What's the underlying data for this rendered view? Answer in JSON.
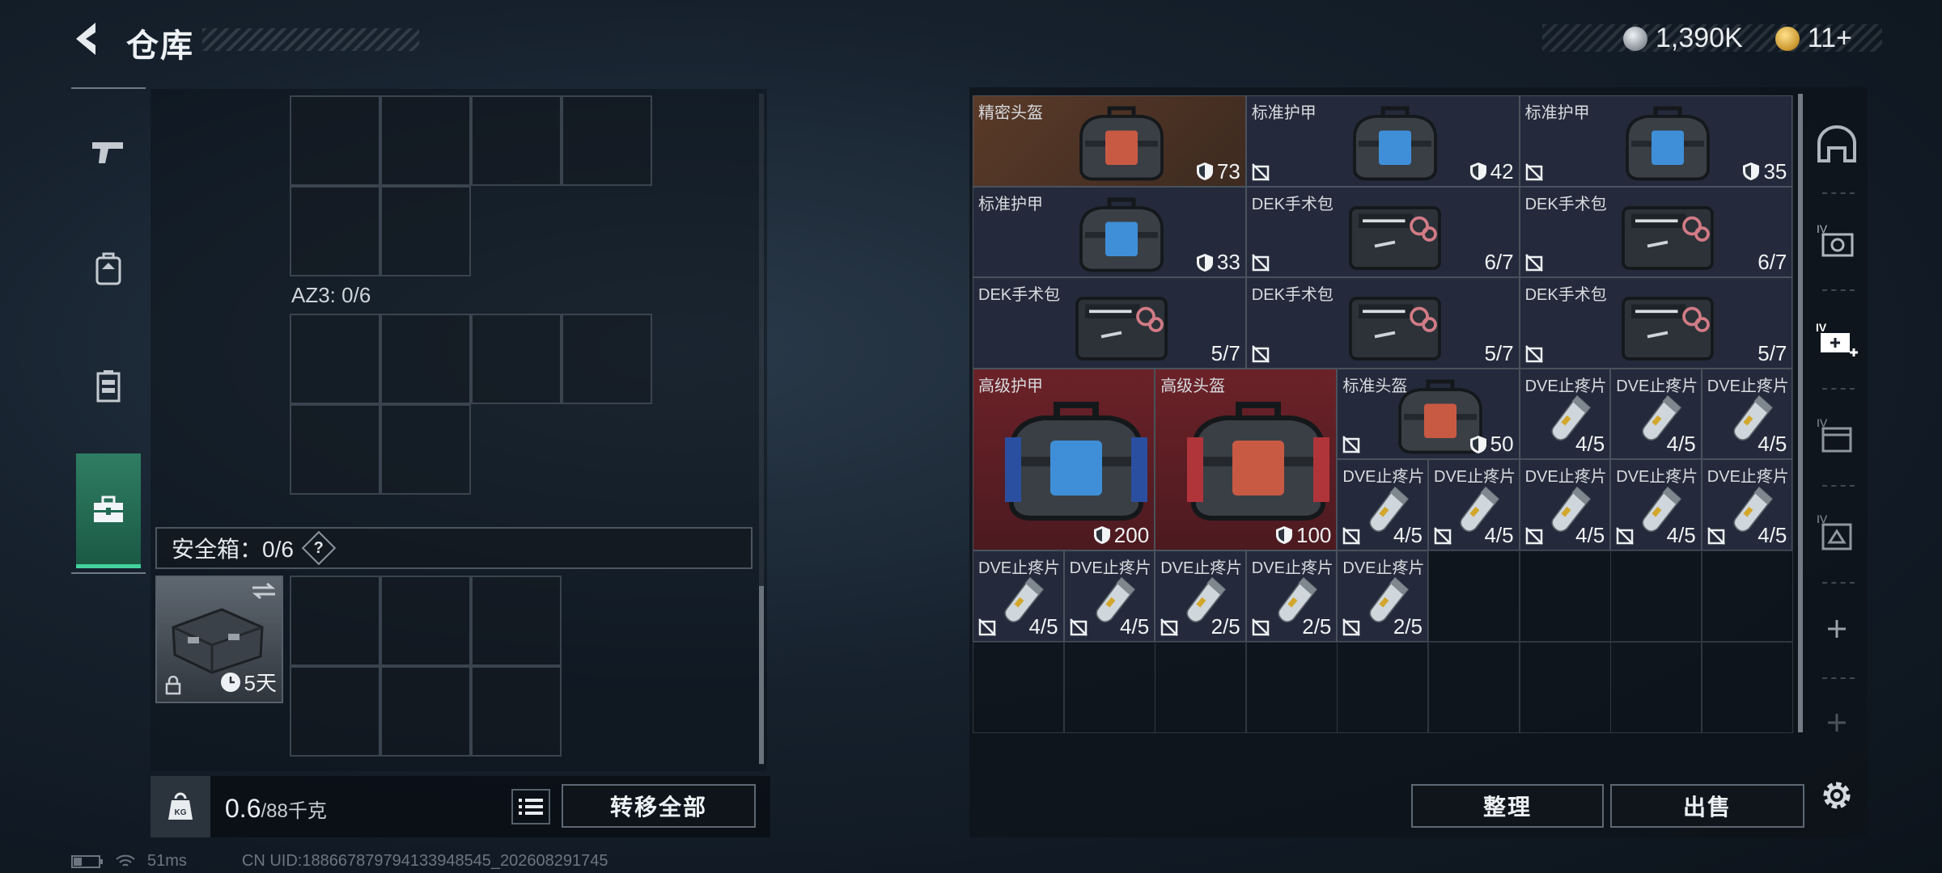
{
  "header": {
    "title": "仓库",
    "currency_1": "1,390K",
    "currency_2": "11+"
  },
  "left_panel": {
    "az3_label": "AZ3: 0/6",
    "safe_box_label": "安全箱：0/6",
    "safe_help": "?",
    "safe_item_duration": "5天",
    "weight_value": "0.6",
    "weight_max": "/88千克",
    "weight_icon_label": "KG",
    "transfer_all": "转移全部"
  },
  "right_panel": {
    "sort_label": "整理",
    "sell_label": "出售",
    "items": [
      {
        "name": "精密头盔",
        "value": "73",
        "bg": "brown",
        "shield": true,
        "noinsure": false,
        "pic": "helmet-case-red"
      },
      {
        "name": "标准护甲",
        "value": "42",
        "bg": "navy",
        "shield": true,
        "noinsure": true,
        "pic": "armor-case-blue"
      },
      {
        "name": "标准护甲",
        "value": "35",
        "bg": "navy",
        "shield": true,
        "noinsure": true,
        "pic": "armor-case-blue"
      },
      {
        "name": "标准护甲",
        "value": "33",
        "bg": "navy",
        "shield": true,
        "noinsure": false,
        "pic": "armor-case-blue"
      },
      {
        "name": "DEK手术包",
        "value": "6/7",
        "bg": "navy",
        "shield": false,
        "noinsure": true,
        "pic": "first-aid-kit"
      },
      {
        "name": "DEK手术包",
        "value": "6/7",
        "bg": "navy",
        "shield": false,
        "noinsure": true,
        "pic": "first-aid-kit"
      },
      {
        "name": "DEK手术包",
        "value": "5/7",
        "bg": "navy",
        "shield": false,
        "noinsure": false,
        "pic": "first-aid-kit"
      },
      {
        "name": "DEK手术包",
        "value": "5/7",
        "bg": "navy",
        "shield": false,
        "noinsure": true,
        "pic": "first-aid-kit"
      },
      {
        "name": "DEK手术包",
        "value": "5/7",
        "bg": "navy",
        "shield": false,
        "noinsure": true,
        "pic": "first-aid-kit"
      },
      {
        "name": "高级护甲",
        "value": "200",
        "bg": "red",
        "shield": true,
        "noinsure": false,
        "pic": "armor-case-large"
      },
      {
        "name": "高级头盔",
        "value": "100",
        "bg": "red",
        "shield": true,
        "noinsure": false,
        "pic": "helmet-case-large"
      },
      {
        "name": "标准头盔",
        "value": "50",
        "bg": "navy",
        "shield": true,
        "noinsure": true,
        "pic": "helmet-case-red"
      },
      {
        "name": "DVE止疼片",
        "value": "4/5",
        "bg": "navy",
        "shield": false,
        "noinsure": false,
        "pic": "pill-canister"
      },
      {
        "name": "DVE止疼片",
        "value": "4/5",
        "bg": "navy",
        "shield": false,
        "noinsure": false,
        "pic": "pill-canister"
      },
      {
        "name": "DVE止疼片",
        "value": "4/5",
        "bg": "navy",
        "shield": false,
        "noinsure": false,
        "pic": "pill-canister"
      },
      {
        "name": "DVE止疼片",
        "value": "4/5",
        "bg": "navy",
        "shield": false,
        "noinsure": true,
        "pic": "pill-canister"
      },
      {
        "name": "DVE止疼片",
        "value": "4/5",
        "bg": "navy",
        "shield": false,
        "noinsure": true,
        "pic": "pill-canister"
      },
      {
        "name": "DVE止疼片",
        "value": "4/5",
        "bg": "navy",
        "shield": false,
        "noinsure": true,
        "pic": "pill-canister"
      },
      {
        "name": "DVE止疼片",
        "value": "4/5",
        "bg": "navy",
        "shield": false,
        "noinsure": true,
        "pic": "pill-canister"
      },
      {
        "name": "DVE止疼片",
        "value": "4/5",
        "bg": "navy",
        "shield": false,
        "noinsure": true,
        "pic": "pill-canister"
      },
      {
        "name": "DVE止疼片",
        "value": "4/5",
        "bg": "navy",
        "shield": false,
        "noinsure": true,
        "pic": "pill-canister"
      },
      {
        "name": "DVE止疼片",
        "value": "4/5",
        "bg": "navy",
        "shield": false,
        "noinsure": true,
        "pic": "pill-canister"
      },
      {
        "name": "DVE止疼片",
        "value": "2/5",
        "bg": "navy",
        "shield": false,
        "noinsure": true,
        "pic": "pill-canister"
      },
      {
        "name": "DVE止疼片",
        "value": "2/5",
        "bg": "navy",
        "shield": false,
        "noinsure": true,
        "pic": "pill-canister"
      },
      {
        "name": "DVE止疼片",
        "value": "2/5",
        "bg": "navy",
        "shield": false,
        "noinsure": true,
        "pic": "pill-canister"
      }
    ]
  },
  "status": {
    "ping": "51ms",
    "uid": "CN UID:1886678797941339485​45_202608291745"
  },
  "colors": {
    "accent_green": "#43d39d",
    "item_brown": "#5a3a28",
    "item_navy": "#242a3b",
    "item_red": "#6b2228"
  },
  "icons": {
    "nav": [
      "pistol-icon",
      "backpack-icon",
      "chest-rig-icon",
      "toolbox-icon"
    ],
    "side": [
      "helmet-slot-icon",
      "level4-armor-icon",
      "level4-medkit-add-icon",
      "level4-box-icon",
      "level4-bag-icon",
      "add-icon",
      "add-icon-disabled",
      "settings-icon"
    ]
  }
}
